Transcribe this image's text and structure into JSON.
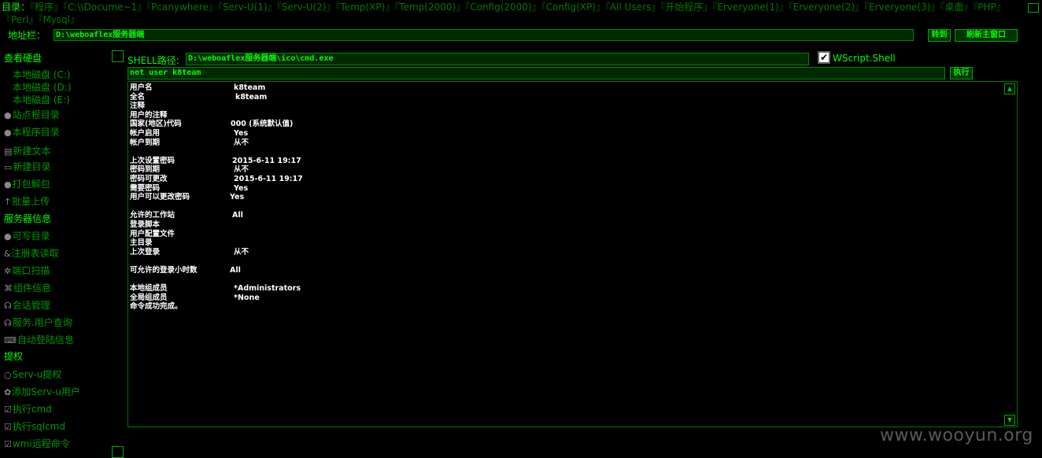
{
  "dir": {
    "lead": "目录：",
    "links": [
      "『程序』",
      "『C:\\\\Docume~1』",
      "『Pcanywhere』",
      "『Serv-U(1)』",
      "『Serv-U(2)』",
      "『Temp(XP)』",
      "『Temp(2000)』",
      "『Config(2000)』",
      "『Config(XP)』",
      "『All Users』",
      "『开始程序』",
      "『Erveryone(1)』",
      "『Erveryone(2)』",
      "『Erveryone(3)』",
      "『桌面』",
      "『PHP』",
      "『Perl』",
      "『Mysql』"
    ]
  },
  "address": {
    "label": "地址栏：",
    "value": "D:\\weboaflex服务器端",
    "goto": "转到",
    "refresh": "刷新主窗口"
  },
  "sidebar": {
    "disk_header": "查看硬盘",
    "disks": [
      "本地磁盘 (C:)",
      "本地磁盘 (D:)",
      "本地磁盘 (E:)"
    ],
    "site_root": "站点根目录",
    "prog_dir": "本程序目录",
    "new_text": "新建文本",
    "new_dir": "新建目录",
    "pack": "打包解包",
    "upload": "批量上传",
    "server_header": "服务器信息",
    "writable": "可写目录",
    "registry": "注册表读取",
    "port_scan": "端口扫描",
    "components": "组件信息",
    "sessions": "会话管理",
    "services": "服务.用户查询",
    "autologon": "自动登陆信息",
    "priv_header": "提权",
    "servu": "Serv-u提权",
    "add_servu": "添加Serv-u用户",
    "exec_cmd": "执行cmd",
    "exec_sql": "执行sqlcmd",
    "wmi": "wmi远程命令"
  },
  "shell": {
    "label": "SHELL路径:",
    "path": "D:\\weboaflex服务器端\\ico\\cmd.exe",
    "wscript_label": "WScript.Shell",
    "wscript_checked": true,
    "command": "net user k8team",
    "exec": "执行"
  },
  "output": [
    {
      "k": "用户名",
      "v": "k8team"
    },
    {
      "k": "全名",
      "v": "k8team"
    },
    {
      "k": "注释",
      "v": ""
    },
    {
      "k": "用户的注释",
      "v": ""
    },
    {
      "k": "国家(地区)代码",
      "v": "000 (系统默认值)"
    },
    {
      "k": "帐户启用",
      "v": "Yes"
    },
    {
      "k": "帐户到期",
      "v": "从不"
    },
    {
      "k": "",
      "v": ""
    },
    {
      "k": "上次设置密码",
      "v": "2015-6-11 19:17"
    },
    {
      "k": "密码到期",
      "v": "从不"
    },
    {
      "k": "密码可更改",
      "v": "2015-6-11 19:17"
    },
    {
      "k": "需要密码",
      "v": "Yes"
    },
    {
      "k": "用户可以更改密码",
      "v": "Yes"
    },
    {
      "k": "",
      "v": ""
    },
    {
      "k": "允许的工作站",
      "v": "All"
    },
    {
      "k": "登录脚本",
      "v": ""
    },
    {
      "k": "用户配置文件",
      "v": ""
    },
    {
      "k": "主目录",
      "v": ""
    },
    {
      "k": "上次登录",
      "v": "从不"
    },
    {
      "k": "",
      "v": ""
    },
    {
      "k": "可允许的登录小时数",
      "v": "All"
    },
    {
      "k": "",
      "v": ""
    },
    {
      "k": "本地组成员",
      "v": "*Administrators"
    },
    {
      "k": "全局组成员",
      "v": "*None"
    },
    {
      "k": "命令成功完成。",
      "v": ""
    }
  ],
  "watermark": "www.wooyun.org",
  "colors": {
    "accent": "#00ff00",
    "dim": "#009900",
    "input_bg": "#002a00"
  }
}
